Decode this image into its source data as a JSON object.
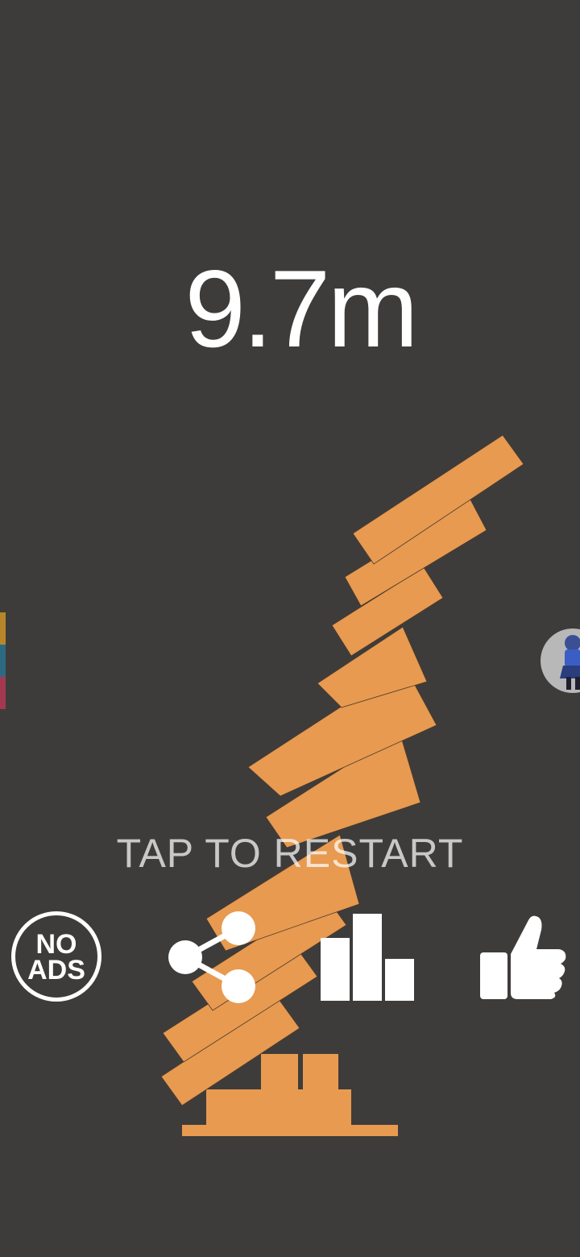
{
  "hud": {
    "height_score": "9.7m",
    "restart_prompt": "TAP TO RESTART"
  },
  "buttons": {
    "no_ads_line1": "NO",
    "no_ads_line2": "ADS",
    "share_icon": "share-icon",
    "leaderboard_icon": "bar-chart-icon",
    "rate_icon": "thumbs-up-icon"
  },
  "colors": {
    "background": "#3e3c3b",
    "block": "#e79a50",
    "text": "#ffffff",
    "side_strip": [
      "#b8862a",
      "#2d6a82",
      "#a43851"
    ]
  }
}
